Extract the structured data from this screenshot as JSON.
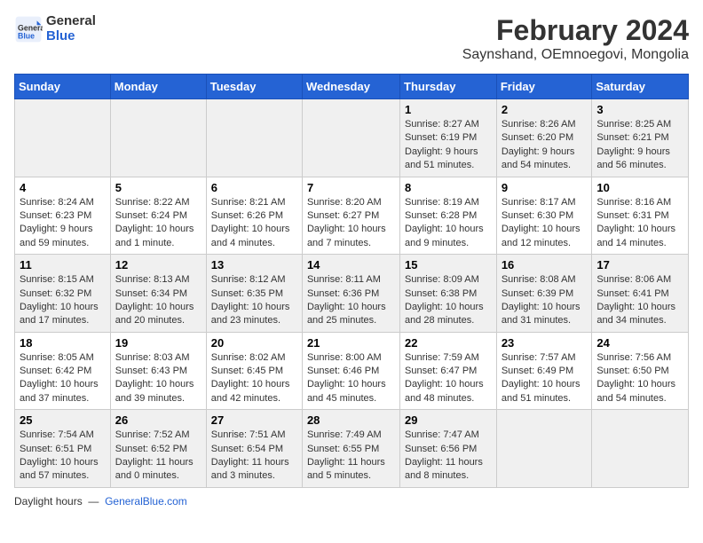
{
  "title": "February 2024",
  "subtitle": "Saynshand, OEmnoegovi, Mongolia",
  "logo": {
    "line1": "General",
    "line2": "Blue"
  },
  "days_of_week": [
    "Sunday",
    "Monday",
    "Tuesday",
    "Wednesday",
    "Thursday",
    "Friday",
    "Saturday"
  ],
  "weeks": [
    [
      {
        "day": "",
        "sunrise": "",
        "sunset": "",
        "daylight": ""
      },
      {
        "day": "",
        "sunrise": "",
        "sunset": "",
        "daylight": ""
      },
      {
        "day": "",
        "sunrise": "",
        "sunset": "",
        "daylight": ""
      },
      {
        "day": "",
        "sunrise": "",
        "sunset": "",
        "daylight": ""
      },
      {
        "day": "1",
        "sunrise": "8:27 AM",
        "sunset": "6:19 PM",
        "daylight": "9 hours and 51 minutes."
      },
      {
        "day": "2",
        "sunrise": "8:26 AM",
        "sunset": "6:20 PM",
        "daylight": "9 hours and 54 minutes."
      },
      {
        "day": "3",
        "sunrise": "8:25 AM",
        "sunset": "6:21 PM",
        "daylight": "9 hours and 56 minutes."
      }
    ],
    [
      {
        "day": "4",
        "sunrise": "8:24 AM",
        "sunset": "6:23 PM",
        "daylight": "9 hours and 59 minutes."
      },
      {
        "day": "5",
        "sunrise": "8:22 AM",
        "sunset": "6:24 PM",
        "daylight": "10 hours and 1 minute."
      },
      {
        "day": "6",
        "sunrise": "8:21 AM",
        "sunset": "6:26 PM",
        "daylight": "10 hours and 4 minutes."
      },
      {
        "day": "7",
        "sunrise": "8:20 AM",
        "sunset": "6:27 PM",
        "daylight": "10 hours and 7 minutes."
      },
      {
        "day": "8",
        "sunrise": "8:19 AM",
        "sunset": "6:28 PM",
        "daylight": "10 hours and 9 minutes."
      },
      {
        "day": "9",
        "sunrise": "8:17 AM",
        "sunset": "6:30 PM",
        "daylight": "10 hours and 12 minutes."
      },
      {
        "day": "10",
        "sunrise": "8:16 AM",
        "sunset": "6:31 PM",
        "daylight": "10 hours and 14 minutes."
      }
    ],
    [
      {
        "day": "11",
        "sunrise": "8:15 AM",
        "sunset": "6:32 PM",
        "daylight": "10 hours and 17 minutes."
      },
      {
        "day": "12",
        "sunrise": "8:13 AM",
        "sunset": "6:34 PM",
        "daylight": "10 hours and 20 minutes."
      },
      {
        "day": "13",
        "sunrise": "8:12 AM",
        "sunset": "6:35 PM",
        "daylight": "10 hours and 23 minutes."
      },
      {
        "day": "14",
        "sunrise": "8:11 AM",
        "sunset": "6:36 PM",
        "daylight": "10 hours and 25 minutes."
      },
      {
        "day": "15",
        "sunrise": "8:09 AM",
        "sunset": "6:38 PM",
        "daylight": "10 hours and 28 minutes."
      },
      {
        "day": "16",
        "sunrise": "8:08 AM",
        "sunset": "6:39 PM",
        "daylight": "10 hours and 31 minutes."
      },
      {
        "day": "17",
        "sunrise": "8:06 AM",
        "sunset": "6:41 PM",
        "daylight": "10 hours and 34 minutes."
      }
    ],
    [
      {
        "day": "18",
        "sunrise": "8:05 AM",
        "sunset": "6:42 PM",
        "daylight": "10 hours and 37 minutes."
      },
      {
        "day": "19",
        "sunrise": "8:03 AM",
        "sunset": "6:43 PM",
        "daylight": "10 hours and 39 minutes."
      },
      {
        "day": "20",
        "sunrise": "8:02 AM",
        "sunset": "6:45 PM",
        "daylight": "10 hours and 42 minutes."
      },
      {
        "day": "21",
        "sunrise": "8:00 AM",
        "sunset": "6:46 PM",
        "daylight": "10 hours and 45 minutes."
      },
      {
        "day": "22",
        "sunrise": "7:59 AM",
        "sunset": "6:47 PM",
        "daylight": "10 hours and 48 minutes."
      },
      {
        "day": "23",
        "sunrise": "7:57 AM",
        "sunset": "6:49 PM",
        "daylight": "10 hours and 51 minutes."
      },
      {
        "day": "24",
        "sunrise": "7:56 AM",
        "sunset": "6:50 PM",
        "daylight": "10 hours and 54 minutes."
      }
    ],
    [
      {
        "day": "25",
        "sunrise": "7:54 AM",
        "sunset": "6:51 PM",
        "daylight": "10 hours and 57 minutes."
      },
      {
        "day": "26",
        "sunrise": "7:52 AM",
        "sunset": "6:52 PM",
        "daylight": "11 hours and 0 minutes."
      },
      {
        "day": "27",
        "sunrise": "7:51 AM",
        "sunset": "6:54 PM",
        "daylight": "11 hours and 3 minutes."
      },
      {
        "day": "28",
        "sunrise": "7:49 AM",
        "sunset": "6:55 PM",
        "daylight": "11 hours and 5 minutes."
      },
      {
        "day": "29",
        "sunrise": "7:47 AM",
        "sunset": "6:56 PM",
        "daylight": "11 hours and 8 minutes."
      },
      {
        "day": "",
        "sunrise": "",
        "sunset": "",
        "daylight": ""
      },
      {
        "day": "",
        "sunrise": "",
        "sunset": "",
        "daylight": ""
      }
    ]
  ],
  "footer": {
    "source": "Daylight hours",
    "url_text": "GeneralBlue.com"
  }
}
